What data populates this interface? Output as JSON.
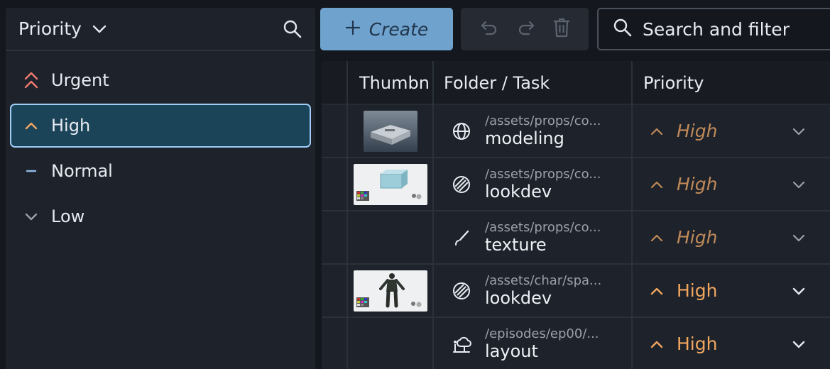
{
  "sidebar": {
    "title": "Priority",
    "items": [
      {
        "label": "Urgent",
        "icon": "double-chevron-up-icon",
        "color": "#f07a72"
      },
      {
        "label": "High",
        "icon": "chevron-up-icon",
        "color": "#f1a65f",
        "selected": true
      },
      {
        "label": "Normal",
        "icon": "dash-icon",
        "color": "#8fb8e8"
      },
      {
        "label": "Low",
        "icon": "chevron-down-icon",
        "color": "#9aa1ab"
      }
    ]
  },
  "toolbar": {
    "create_label": "Create",
    "search_placeholder": "Search and filter"
  },
  "table": {
    "columns": [
      "Thumbn",
      "Folder / Task",
      "Priority"
    ],
    "rows": [
      {
        "path": "/assets/props/co...",
        "task": "modeling",
        "task_icon": "globe-icon",
        "priority": "High",
        "thumbnail": "case-render"
      },
      {
        "path": "/assets/props/co...",
        "task": "lookdev",
        "task_icon": "shading-sphere-icon",
        "priority": "High",
        "thumbnail": "crate-render"
      },
      {
        "path": "/assets/props/co...",
        "task": "texture",
        "task_icon": "brush-icon",
        "priority": "High",
        "thumbnail": ""
      },
      {
        "path": "/assets/char/spa...",
        "task": "lookdev",
        "task_icon": "shading-sphere-icon",
        "priority": "High",
        "thumbnail": "character-render"
      },
      {
        "path": "/episodes/ep00/...",
        "task": "layout",
        "task_icon": "layout-tree-icon",
        "priority": "High",
        "thumbnail": ""
      }
    ]
  },
  "colors": {
    "accent": "#6fa2cd",
    "priority_high": "#f1a65f",
    "selection_border": "#9fcdf6"
  }
}
